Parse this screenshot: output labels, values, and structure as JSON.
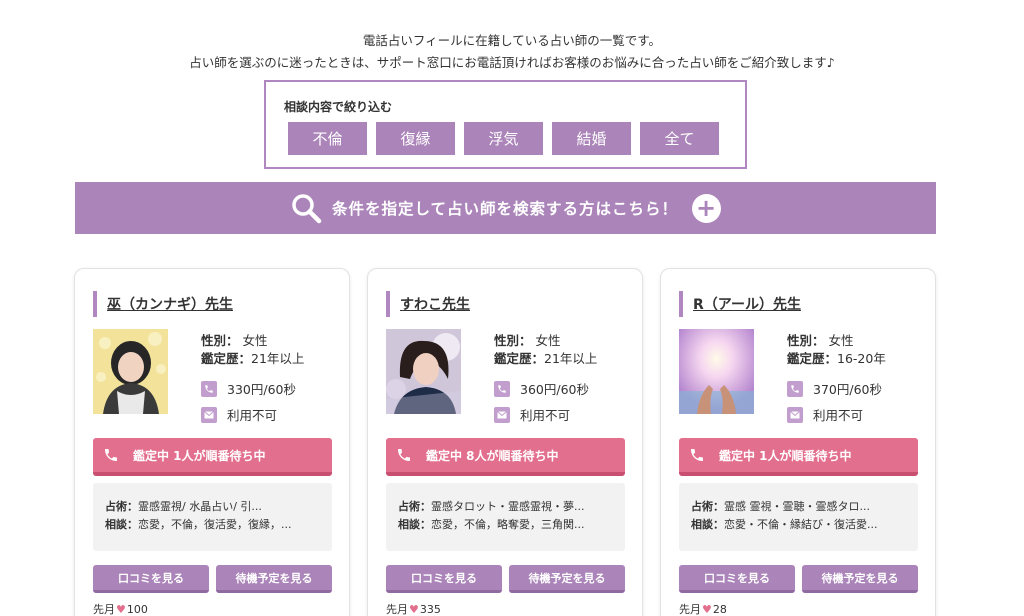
{
  "intro": {
    "line1": "電話占いフィールに在籍している占い師の一覧です。",
    "line2": "占い師を選ぶのに迷ったときは、サポート窓口にお電話頂ければお客様のお悩みに合った占い師をご紹介致します♪"
  },
  "filter": {
    "title": "相談内容で絞り込む",
    "buttons": [
      "不倫",
      "復縁",
      "浮気",
      "結婚",
      "全て"
    ]
  },
  "search": {
    "label": "条件を指定して占い師を検索する方はこちら！",
    "icon": "search-icon",
    "action_icon": "plus-icon",
    "plus_glyph": "+"
  },
  "colors": {
    "accent": "#ab84b9",
    "status": "#e26f8d",
    "detail_bg": "#f2f2f2"
  },
  "cards": [
    {
      "name": "巫（カンナギ）先生",
      "gender_label": "性別：",
      "gender": "女性",
      "career_label": "鑑定歴：",
      "career": "21年以上",
      "price": "330円/60秒",
      "mail": "利用不可",
      "status": "鑑定中 1人が順番待ち中",
      "skill_label": "占術：",
      "skills": "霊感霊視/ 水晶占い/ 引...",
      "consult_label": "相談：",
      "consults": "恋愛，不倫，復活愛，復縁，...",
      "review_btn": "口コミを見る",
      "schedule_btn": "待機予定を見る",
      "likes_prefix": "先月",
      "likes_heart": "♥",
      "likes": "100"
    },
    {
      "name": "すわこ先生",
      "gender_label": "性別：",
      "gender": "女性",
      "career_label": "鑑定歴：",
      "career": "21年以上",
      "price": "360円/60秒",
      "mail": "利用不可",
      "status": "鑑定中 8人が順番待ち中",
      "skill_label": "占術：",
      "skills": "霊感タロット・霊感霊視・夢...",
      "consult_label": "相談：",
      "consults": "恋愛，不倫，略奪愛，三角関...",
      "review_btn": "口コミを見る",
      "schedule_btn": "待機予定を見る",
      "likes_prefix": "先月",
      "likes_heart": "♥",
      "likes": "335"
    },
    {
      "name": "R（アール）先生",
      "gender_label": "性別：",
      "gender": "女性",
      "career_label": "鑑定歴：",
      "career": "16-20年",
      "price": "370円/60秒",
      "mail": "利用不可",
      "status": "鑑定中 1人が順番待ち中",
      "skill_label": "占術：",
      "skills": "霊感 霊視・霊聴・霊感タロ...",
      "consult_label": "相談：",
      "consults": "恋愛・不倫・縁結び・復活愛...",
      "review_btn": "口コミを見る",
      "schedule_btn": "待機予定を見る",
      "likes_prefix": "先月",
      "likes_heart": "♥",
      "likes": "28"
    }
  ]
}
